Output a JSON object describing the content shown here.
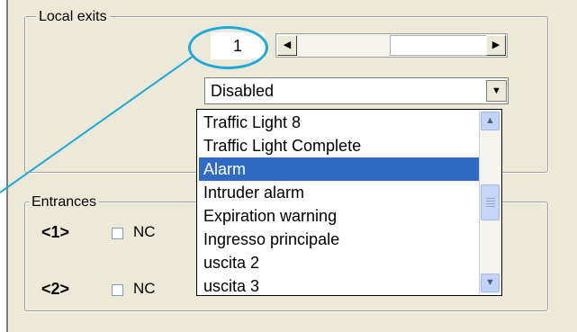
{
  "local_exits": {
    "title": "Local exits",
    "exit_number": "1",
    "scroll_left_glyph": "◀",
    "scroll_right_glyph": "▶",
    "combo_value": "Disabled",
    "combo_arrow_glyph": "▼"
  },
  "dropdown": {
    "items": [
      "Traffic Light 8",
      "Traffic Light Complete",
      "Alarm",
      "Intruder alarm",
      "Expiration warning",
      "Ingresso principale",
      "uscita  2",
      "uscita  3"
    ],
    "selected_index": 2,
    "up_glyph": "▲",
    "down_glyph": "▼"
  },
  "entrances": {
    "title": "Entrances",
    "rows": [
      {
        "label": "<1>",
        "checkbox_label": "NC",
        "checked": false
      },
      {
        "label": "<2>",
        "checkbox_label": "NC",
        "checked": false
      }
    ]
  },
  "colors": {
    "panel_bg": "#ece9d8",
    "selection": "#316ac5",
    "callout": "#1fa9dc"
  }
}
